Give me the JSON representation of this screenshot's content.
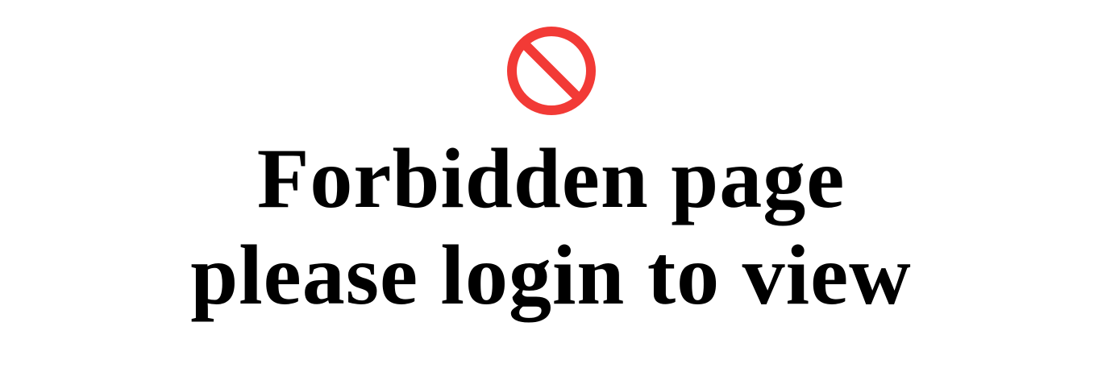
{
  "icon": {
    "name": "forbidden-icon",
    "color": "#f23a36"
  },
  "message": {
    "line1": "Forbidden page",
    "line2": "please login to view"
  }
}
